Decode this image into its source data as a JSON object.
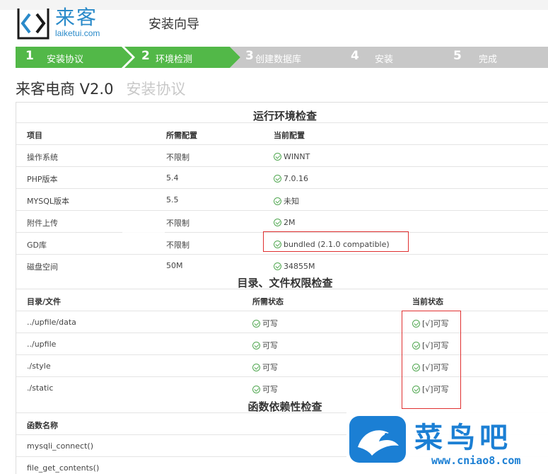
{
  "header": {
    "logo_cn": "来客",
    "logo_en": "laiketui.com",
    "wizard_title": "安装向导"
  },
  "steps": [
    {
      "num": "1",
      "label": "安装协议",
      "state": "done"
    },
    {
      "num": "2",
      "label": "环境检测",
      "state": "active"
    },
    {
      "num": "3",
      "label": "创建数据库",
      "state": "todo"
    },
    {
      "num": "4",
      "label": "安装",
      "state": "todo"
    },
    {
      "num": "5",
      "label": "完成",
      "state": "todo"
    }
  ],
  "product": {
    "name": "来客电商 V2.0",
    "subtitle": "安装协议"
  },
  "env_check": {
    "title": "运行环境检查",
    "headers": [
      "项目",
      "所需配置",
      "当前配置"
    ],
    "rows": [
      [
        "操作系统",
        "不限制",
        "WINNT"
      ],
      [
        "PHP版本",
        "5.4",
        "7.0.16"
      ],
      [
        "MYSQL版本",
        "5.5",
        "未知"
      ],
      [
        "附件上传",
        "不限制",
        "2M"
      ],
      [
        "GD库",
        "不限制",
        "bundled (2.1.0 compatible)"
      ],
      [
        "磁盘空间",
        "50M",
        "34855M"
      ]
    ]
  },
  "dir_check": {
    "title": "目录、文件权限检查",
    "headers": [
      "目录/文件",
      "所需状态",
      "当前状态"
    ],
    "rows": [
      [
        "../upfile/data",
        "可写",
        "[√]可写"
      ],
      [
        "../upfile",
        "可写",
        "[√]可写"
      ],
      [
        "./style",
        "可写",
        "[√]可写"
      ],
      [
        "./static",
        "可写",
        "[√]可写"
      ]
    ]
  },
  "func_check": {
    "title": "函数依赖性检查",
    "headers": [
      "函数名称"
    ],
    "rows": [
      [
        "mysqli_connect()"
      ],
      [
        "file_get_contents()"
      ]
    ]
  },
  "watermark": {
    "cn": "菜鸟吧",
    "url": "www.cniao8.com"
  },
  "colors": {
    "step_done": "#52b848",
    "step_todo": "#c8c8c8",
    "brand": "#2a8ac9",
    "ok": "#52a852",
    "highlight": "#e03030"
  }
}
